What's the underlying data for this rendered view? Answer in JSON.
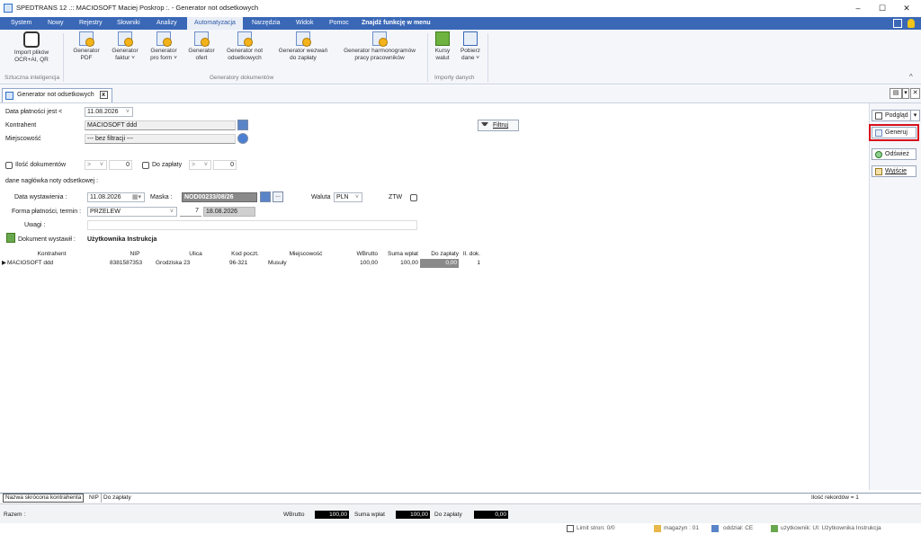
{
  "window": {
    "title": "SPEDTRANS 12 .:: MACIOSOFT Maciej Poskrop :. - Generator not odsetkowych",
    "minimize": "–",
    "maximize": "☐",
    "close": "✕"
  },
  "menu": {
    "items": [
      "System",
      "Nowy",
      "Rejestry",
      "Słowniki",
      "Analizy",
      "Automatyzacja",
      "Narzędzia",
      "Widok",
      "Pomoc"
    ],
    "search_placeholder": "Znajdź funkcję w menu"
  },
  "ribbon": {
    "ai_button": "Import plików\nOCR+AI, QR",
    "ai_group": "Sztuczna inteligencja",
    "doc_buttons": [
      "Generator\nPDF",
      "Generator\nfaktur ˅",
      "Generator\npro form ˅",
      "Generator\nofert",
      "Generator not\nodsetkowych",
      "Generator wezwań\ndo zapłaty",
      "Generator harmonogramów\npracy pracowników"
    ],
    "doc_group": "Generatory dokumentów",
    "import_buttons": [
      "Kursy\nwalut",
      "Pobierz\ndane ˅"
    ],
    "import_group": "Importy danych",
    "collapse": "^"
  },
  "doc_tab": {
    "label": "Generator not odsetkowych",
    "close": "x"
  },
  "filters": {
    "payment_date_label": "Data płatności jest <",
    "payment_date_value": "11.08.2026",
    "contractor_label": "Kontrahent",
    "contractor_value": "MACIOSOFT ddd",
    "city_label": "Miejscowość",
    "city_value": "--- bez filtracji ---",
    "filter_button": "Filtruj",
    "doc_count_label": "Ilość dokumentów",
    "doc_count_op": ">",
    "doc_count_value": "0",
    "to_pay_label": "Do zapłaty",
    "to_pay_op": ">",
    "to_pay_value": "0"
  },
  "header": {
    "section_label": "dane nagłówka noty odsetkowej :",
    "issue_date_label": "Data wystawienia :",
    "issue_date_value": "11.08.2026",
    "mask_label": "Maska :",
    "mask_value": "NOD00233/08/26",
    "more": "...",
    "currency_label": "Waluta",
    "currency_value": "PLN",
    "ztw_label": "ZTW",
    "payment_form_label": "Forma płatności, termin :",
    "payment_form_value": "PRZELEW",
    "term_days": "7",
    "term_date": "18.08.2026",
    "notes_label": "Uwagi :",
    "issued_by_label": "Dokument wystawił :",
    "issued_by_value": "Użytkownika Instrukcja"
  },
  "grid": {
    "columns": [
      "Kontrahent",
      "NIP",
      "Ulica",
      "Kod poczt.",
      "Miejscowość",
      "WBrutto",
      "Suma wpłat",
      "Do zapłaty",
      "Il. dok."
    ],
    "rows": [
      {
        "marker": "▶",
        "kontrahent": "MACIOSOFT ddd",
        "nip": "8381587353",
        "ulica": "Grodziska 23",
        "kod": "96-321",
        "miejscowosc": "Musuły",
        "wbrutto": "100,00",
        "suma": "100,00",
        "dozaplaty": "0,00",
        "ildok": "1"
      }
    ]
  },
  "right_panel": {
    "preview": "Podgląd",
    "generate": "Generuj",
    "refresh": "Odśwież",
    "exit": "Wyjście"
  },
  "bottom_tabs": [
    "Nazwa skrócona kontrahenta",
    "NIP",
    "Do zapłaty"
  ],
  "record_count": "Ilość rekordów = 1",
  "totals": {
    "label": "Razem :",
    "wbrutto_label": "WBrutto",
    "wbrutto": "100,00",
    "suma_label": "Suma wpłat",
    "suma": "100,00",
    "dozaplaty_label": "Do zapłaty",
    "dozaplaty": "0,00"
  },
  "status": {
    "page_limit": "Limit stron: 0/0",
    "warehouse": "magazyn : 01",
    "branch": "oddział: CE",
    "user": "użytkownik: UI: Użytkownika Instrukcja"
  },
  "colors": {
    "menubar": "#3a68b7",
    "highlight": "#d8101c",
    "dark_cell": "#8a8a8a"
  }
}
